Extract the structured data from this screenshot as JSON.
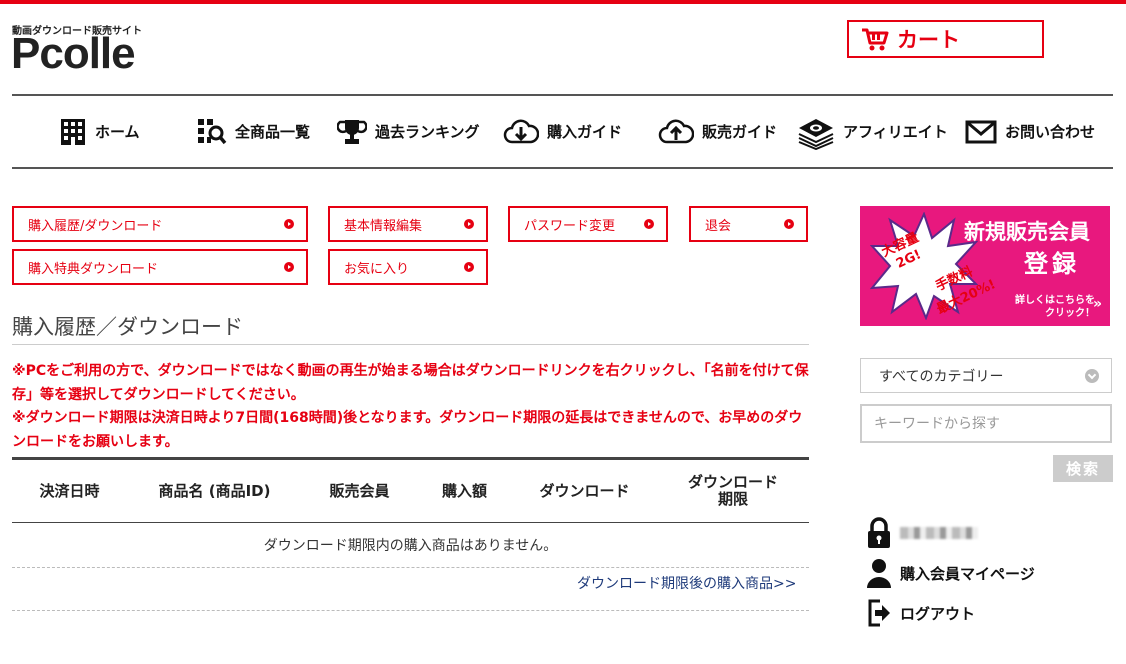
{
  "site": {
    "tagline": "動画ダウンロード販売サイト",
    "logo": "Pcolle",
    "cart_label": "カート"
  },
  "nav": [
    {
      "label": "ホーム",
      "icon": "building-icon"
    },
    {
      "label": "全商品一覧",
      "icon": "grid-search-icon"
    },
    {
      "label": "過去ランキング",
      "icon": "trophy-icon"
    },
    {
      "label": "購入ガイド",
      "icon": "cloud-download-icon"
    },
    {
      "label": "販売ガイド",
      "icon": "cloud-upload-icon"
    },
    {
      "label": "アフィリエイト",
      "icon": "money-stack-icon"
    },
    {
      "label": "お問い合わせ",
      "icon": "mail-icon"
    }
  ],
  "member_menu": [
    "購入履歴/ダウンロード",
    "基本情報編集",
    "パスワード変更",
    "退会",
    "購入特典ダウンロード",
    "お気に入り"
  ],
  "page": {
    "title": "購入履歴／ダウンロード",
    "notice_1": "※PCをご利用の方で、ダウンロードではなく動画の再生が始まる場合はダウンロードリンクを右クリックし、「名前を付けて保存」等を選択してダウンロードしてください。",
    "notice_2": "※ダウンロード期限は決済日時より7日間(168時間)後となります。ダウンロード期限の延長はできませんので、お早めのダウンロードをお願いします。"
  },
  "table": {
    "headers": [
      "決済日時",
      "商品名 (商品ID)",
      "販売会員",
      "購入額",
      "ダウンロード",
      "ダウンロード\n期限"
    ],
    "empty_message": "ダウンロード期限内の購入商品はありません。",
    "after_link": "ダウンロード期限後の購入商品>>"
  },
  "banner": {
    "title_1": "新規販売会員",
    "title_2": "登録",
    "capacity_1": "大容量",
    "capacity_2": "2G!",
    "fee_1": "手数料",
    "fee_2": "最大20%!",
    "detail_1": "詳しくはこちらを",
    "detail_2": "クリック！"
  },
  "sidebar": {
    "category_selected": "すべてのカテゴリー",
    "keyword_placeholder": "キーワードから探す",
    "search_button": "検索",
    "my_page": "購入会員マイページ",
    "logout": "ログアウト"
  },
  "colors": {
    "brand_red": "#e60012",
    "banner_pink": "#e8187e",
    "link_blue": "#1e3a7a"
  }
}
